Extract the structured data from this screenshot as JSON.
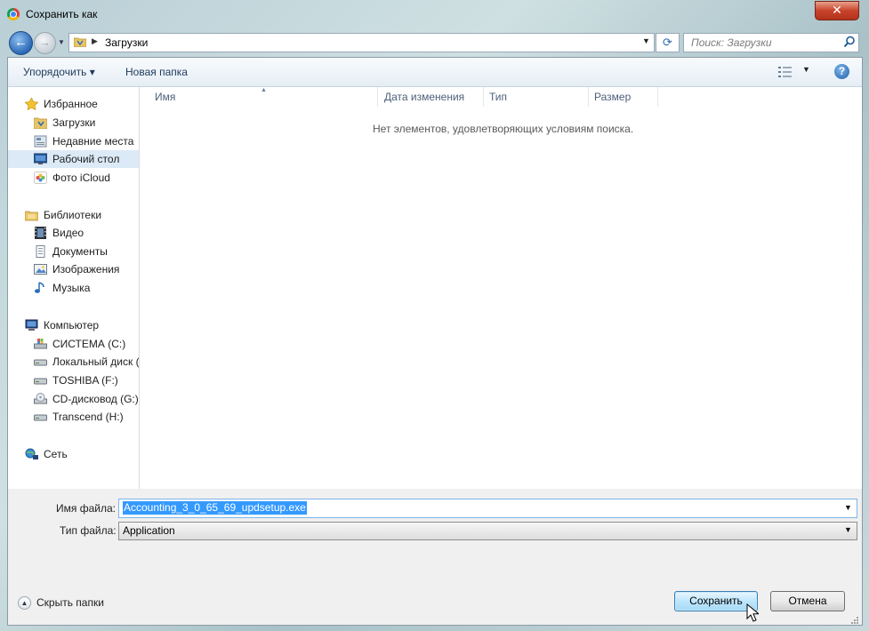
{
  "window": {
    "title": "Сохранить как",
    "close_label": "✕"
  },
  "nav": {
    "address": "Загрузки",
    "search_placeholder": "Поиск: Загрузки"
  },
  "toolbar": {
    "organize_label": "Упорядочить ▾",
    "new_folder_label": "Новая папка",
    "help_label": "?"
  },
  "sidebar": {
    "items": [
      {
        "label": "Избранное",
        "icon": "star-icon"
      },
      {
        "label": "Загрузки",
        "icon": "downloads-folder-icon"
      },
      {
        "label": "Недавние места",
        "icon": "recent-places-icon"
      },
      {
        "label": "Рабочий стол",
        "icon": "desktop-icon",
        "selected": true
      },
      {
        "label": "Фото iCloud",
        "icon": "icloud-photos-icon"
      },
      {
        "label": "Библиотеки",
        "icon": "libraries-icon"
      },
      {
        "label": "Видео",
        "icon": "video-icon"
      },
      {
        "label": "Документы",
        "icon": "documents-icon"
      },
      {
        "label": "Изображения",
        "icon": "pictures-icon"
      },
      {
        "label": "Музыка",
        "icon": "music-icon"
      },
      {
        "label": "Компьютер",
        "icon": "computer-icon"
      },
      {
        "label": "СИСТЕМА (C:)",
        "icon": "system-drive-icon"
      },
      {
        "label": "Локальный диск (",
        "icon": "local-disk-icon"
      },
      {
        "label": "TOSHIBA (F:)",
        "icon": "usb-drive-icon"
      },
      {
        "label": "CD-дисковод (G:)",
        "icon": "cd-drive-icon"
      },
      {
        "label": "Transcend (H:)",
        "icon": "usb-drive-icon"
      },
      {
        "label": "Сеть",
        "icon": "network-icon"
      }
    ]
  },
  "filelist": {
    "columns": [
      "Имя",
      "Дата изменения",
      "Тип",
      "Размер"
    ],
    "empty_message": "Нет элементов, удовлетворяющих условиям поиска."
  },
  "form": {
    "filename_label": "Имя файла:",
    "filename_value": "Accounting_3_0_65_69_updsetup.exe",
    "filetype_label": "Тип файла:",
    "filetype_value": "Application"
  },
  "footer": {
    "hide_folders_label": "Скрыть папки",
    "save_label": "Сохранить",
    "cancel_label": "Отмена"
  },
  "colors": {
    "accent": "#3399ff",
    "selection": "#dceaf7",
    "link_text": "#1e395b"
  }
}
